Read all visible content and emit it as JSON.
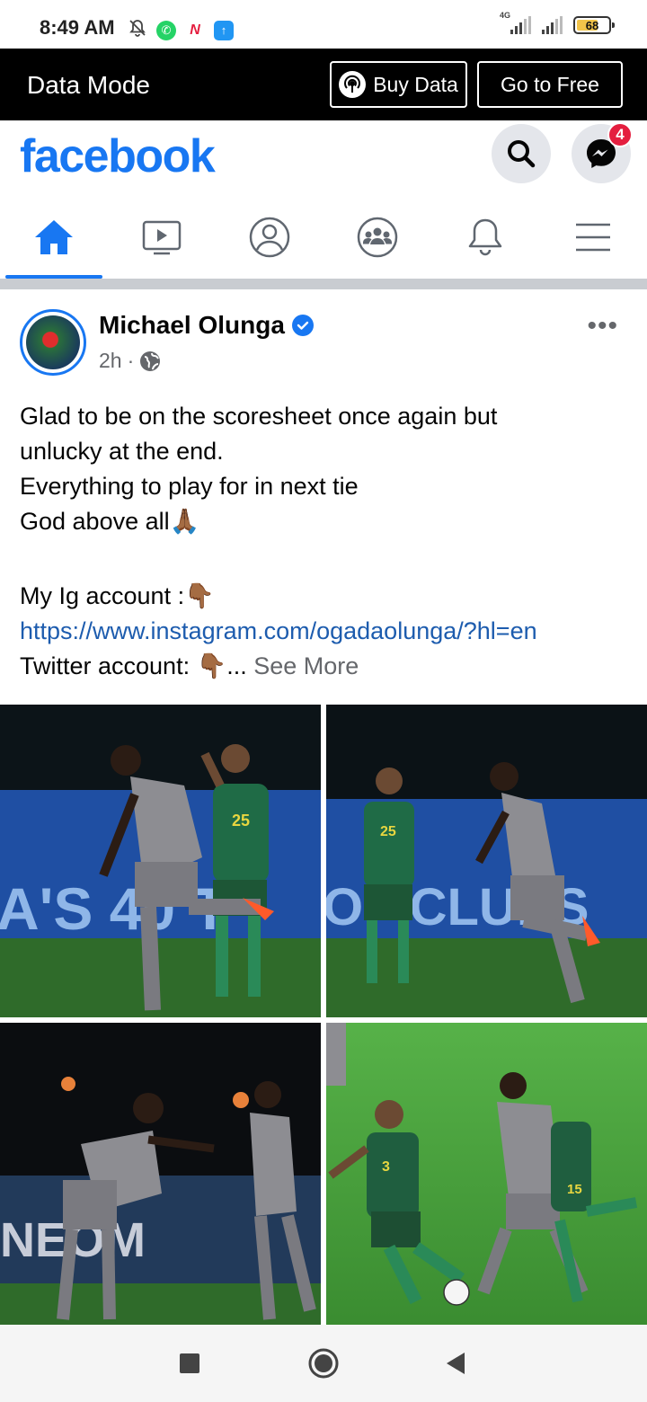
{
  "status_bar": {
    "time": "8:49 AM",
    "network": "4G",
    "battery": "68",
    "battery_level": 0.68
  },
  "data_mode": {
    "title": "Data Mode",
    "buy_label": "Buy Data",
    "free_label": "Go to Free"
  },
  "header": {
    "logo": "facebook",
    "messenger_badge": "4",
    "brand_color": "#1877f2"
  },
  "nav": {
    "tabs": [
      {
        "name": "home",
        "icon": "home-icon",
        "active": true
      },
      {
        "name": "watch",
        "icon": "video-icon",
        "active": false
      },
      {
        "name": "profile",
        "icon": "profile-icon",
        "active": false
      },
      {
        "name": "groups",
        "icon": "groups-icon",
        "active": false
      },
      {
        "name": "notifications",
        "icon": "bell-icon",
        "active": false
      },
      {
        "name": "menu",
        "icon": "hamburger-icon",
        "active": false
      }
    ]
  },
  "post": {
    "author": "Michael Olunga",
    "time": "2h",
    "more": "•••",
    "lines": [
      "Glad to be on the scoresheet once again but",
      "unlucky at the end.",
      "Everything to play for in next tie",
      "God above all🙏🏾"
    ],
    "ig_label": "My Ig account :👇🏾",
    "ig_link": "https://www.instagram.com/ogadaolunga/?hl=en",
    "twitter_label": "Twitter account: 👇🏾... ",
    "see_more": "See More"
  },
  "photos": {
    "banner_text_1": "A'S 40 T",
    "banner_text_2": "OF CLUBS",
    "jersey_1": "25",
    "jersey_2": "25",
    "jersey_3": "3",
    "jersey_4": "15",
    "ad_text": "NEOM"
  }
}
